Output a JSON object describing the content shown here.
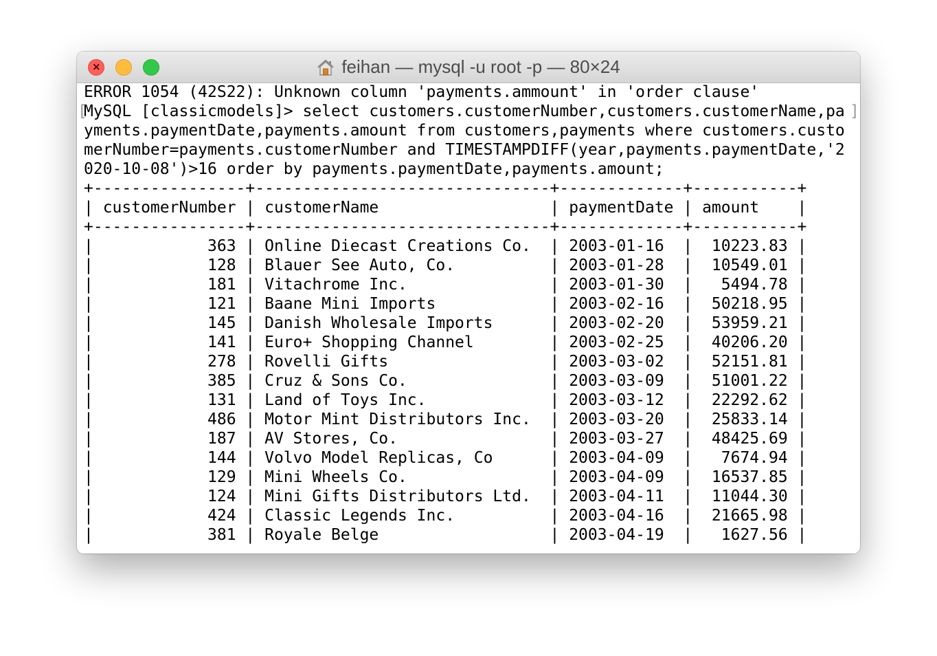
{
  "window": {
    "title": "feihan — mysql -u root -p — 80×24",
    "title_icon": "home-icon"
  },
  "terminal": {
    "lines": [
      "ERROR 1054 (42S22): Unknown column 'payments.ammount' in 'order clause'",
      "MySQL [classicmodels]> select customers.customerNumber,customers.customerName,pa",
      "yments.paymentDate,payments.amount from customers,payments where customers.custo",
      "merNumber=payments.customerNumber and TIMESTAMPDIFF(year,payments.paymentDate,'2",
      "020-10-08')>16 order by payments.paymentDate,payments.amount;",
      "+----------------+-------------------------------+-------------+-----------+",
      "| customerNumber | customerName                  | paymentDate | amount    |",
      "+----------------+-------------------------------+-------------+-----------+",
      "|            363 | Online Diecast Creations Co.  | 2003-01-16  |  10223.83 |",
      "|            128 | Blauer See Auto, Co.          | 2003-01-28  |  10549.01 |",
      "|            181 | Vitachrome Inc.               | 2003-01-30  |   5494.78 |",
      "|            121 | Baane Mini Imports            | 2003-02-16  |  50218.95 |",
      "|            145 | Danish Wholesale Imports      | 2003-02-20  |  53959.21 |",
      "|            141 | Euro+ Shopping Channel        | 2003-02-25  |  40206.20 |",
      "|            278 | Rovelli Gifts                 | 2003-03-02  |  52151.81 |",
      "|            385 | Cruz & Sons Co.               | 2003-03-09  |  51001.22 |",
      "|            131 | Land of Toys Inc.             | 2003-03-12  |  22292.62 |",
      "|            486 | Motor Mint Distributors Inc.  | 2003-03-20  |  25833.14 |",
      "|            187 | AV Stores, Co.                | 2003-03-27  |  48425.69 |",
      "|            144 | Volvo Model Replicas, Co      | 2003-04-09  |   7674.94 |",
      "|            129 | Mini Wheels Co.               | 2003-04-09  |  16537.85 |",
      "|            124 | Mini Gifts Distributors Ltd.  | 2003-04-11  |  11044.30 |",
      "|            424 | Classic Legends Inc.          | 2003-04-16  |  21665.98 |",
      "|            381 | Royale Belge                  | 2003-04-19  |   1627.56 |"
    ]
  }
}
